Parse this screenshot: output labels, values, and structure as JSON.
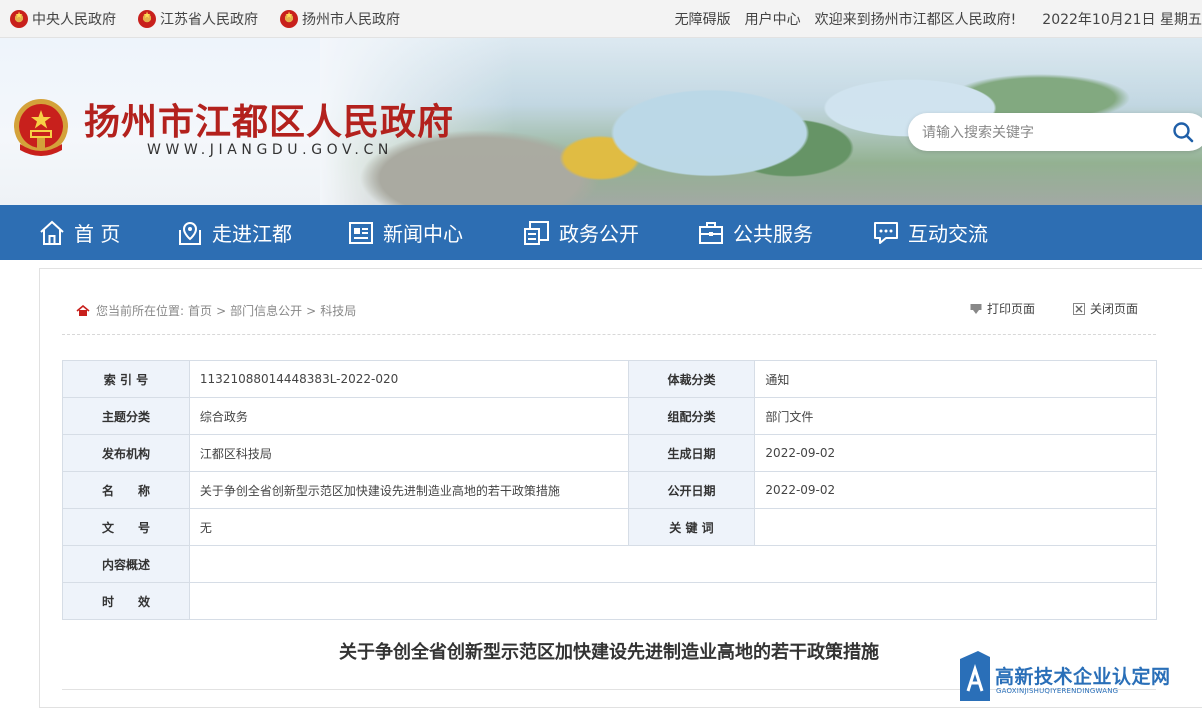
{
  "topbar": {
    "gov_links": [
      "中央人民政府",
      "江苏省人民政府",
      "扬州市人民政府"
    ],
    "accessibility": "无障碍版",
    "user_center": "用户中心",
    "welcome": "欢迎来到扬州市江都区人民政府!",
    "date": "2022年10月21日 星期五"
  },
  "header": {
    "title": "扬州市江都区人民政府",
    "url": "WWW.JIANGDU.GOV.CN",
    "search_placeholder": "请输入搜索关键字"
  },
  "nav": {
    "items": [
      {
        "label": "首 页",
        "icon": "home-icon"
      },
      {
        "label": "走进江都",
        "icon": "map-pin-icon"
      },
      {
        "label": "新闻中心",
        "icon": "newspaper-icon"
      },
      {
        "label": "政务公开",
        "icon": "document-icon"
      },
      {
        "label": "公共服务",
        "icon": "briefcase-icon"
      },
      {
        "label": "互动交流",
        "icon": "chat-icon"
      }
    ]
  },
  "breadcrumb": {
    "prefix": "您当前所在位置:",
    "items": [
      "首页",
      "部门信息公开",
      "科技局"
    ],
    "separator": ">"
  },
  "tools": {
    "print": "打印页面",
    "close": "关闭页面"
  },
  "meta_table": {
    "rows": [
      [
        "索 引 号",
        "11321088014448383L-2022-020",
        "体裁分类",
        "通知"
      ],
      [
        "主题分类",
        "综合政务",
        "组配分类",
        "部门文件"
      ],
      [
        "发布机构",
        "江都区科技局",
        "生成日期",
        "2022-09-02"
      ],
      [
        "名　　称",
        "关于争创全省创新型示范区加快建设先进制造业高地的若干政策措施",
        "公开日期",
        "2022-09-02"
      ],
      [
        "文　　号",
        "无",
        "关 键 词",
        ""
      ]
    ],
    "wide_rows": [
      [
        "内容概述",
        ""
      ],
      [
        "时　　效",
        ""
      ]
    ]
  },
  "document": {
    "title": "关于争创全省创新型示范区加快建设先进制造业高地的若干政策措施"
  },
  "watermark": {
    "text": "高新技术企业认定网",
    "sub": "GAOXINJISHUQIYERENDINGWANG"
  },
  "colors": {
    "nav_bg": "#2d6eb3",
    "title_red": "#b3211d",
    "table_key_bg": "#eef3fa"
  }
}
